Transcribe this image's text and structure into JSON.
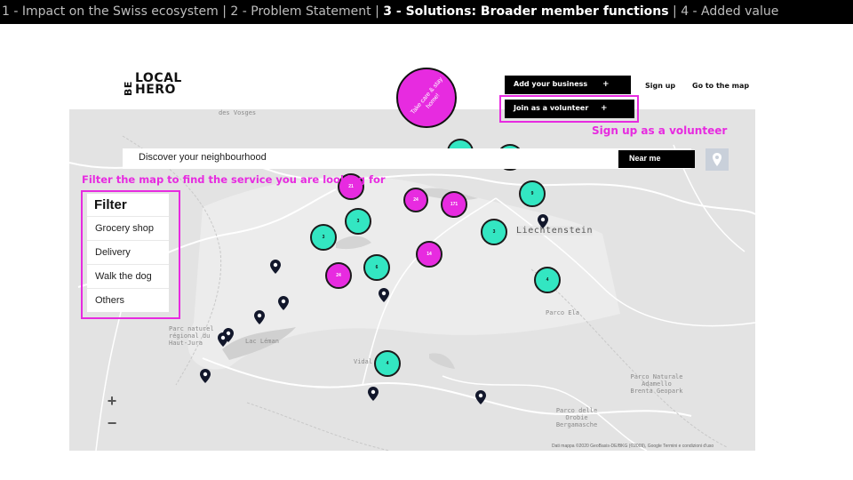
{
  "breadcrumb": {
    "item1": "1 - Impact on the Swiss ecosystem",
    "sep1": " | ",
    "item2": "2 - Problem Statement",
    "sep2": " | ",
    "item3": "3 - Solutions: Broader member functions",
    "sep3": "  | ",
    "item4": "4 - Added value"
  },
  "header": {
    "logo_be": "BE",
    "logo_local": "LOCAL",
    "logo_hero": "HERO",
    "stay_home": "Take care & stay home!",
    "add_business_label": "Add your business",
    "join_volunteer_label": "Join as a volunteer",
    "plus": "+",
    "sign_up": "Sign up",
    "go_to_map": "Go to the map"
  },
  "annotations": {
    "volunteer": "Sign up as a volunteer",
    "filter": "Filter the map to find the service you are looking for"
  },
  "search": {
    "placeholder": "Discover your neighbourhood",
    "near_me": "Near me"
  },
  "filter": {
    "title": "Filter",
    "items": [
      "Grocery shop",
      "Delivery",
      "Walk the dog",
      "Others"
    ]
  },
  "map": {
    "place_labels": {
      "liechtenstein": "Liechtenstein",
      "parco_ela": "Parco Ela",
      "parc_naturel": "Parc naturel régional du Haut-Jura",
      "parco_naturale": "Parco Naturale Adamello Brenta Geopark",
      "parco_orobie": "Parco delle Orobie Bergamasche",
      "des_vosges": "des Vosges",
      "lemanu": "Lac Léman",
      "vidal": "Vidal"
    },
    "clusters": [
      {
        "count": "21",
        "color": "pink"
      },
      {
        "count": "24",
        "color": "pink"
      },
      {
        "count": "171",
        "color": "pink"
      },
      {
        "count": "14",
        "color": "pink"
      },
      {
        "count": "24",
        "color": "pink"
      },
      {
        "count": "3",
        "color": "teal"
      },
      {
        "count": "3",
        "color": "teal"
      },
      {
        "count": "6",
        "color": "teal"
      },
      {
        "count": "3",
        "color": "teal"
      },
      {
        "count": "9",
        "color": "teal"
      },
      {
        "count": "4",
        "color": "teal"
      },
      {
        "count": "4",
        "color": "teal"
      }
    ],
    "attribution": "Dati mappa ©2020 GeoBasis-DE/BKG (©2009), Google   Termini e condizioni d'uso",
    "zoom_in": "+",
    "zoom_out": "−"
  },
  "colors": {
    "accent_pink": "#e72be0",
    "accent_teal": "#33e6c2",
    "map_bg": "#e3e3e3"
  }
}
